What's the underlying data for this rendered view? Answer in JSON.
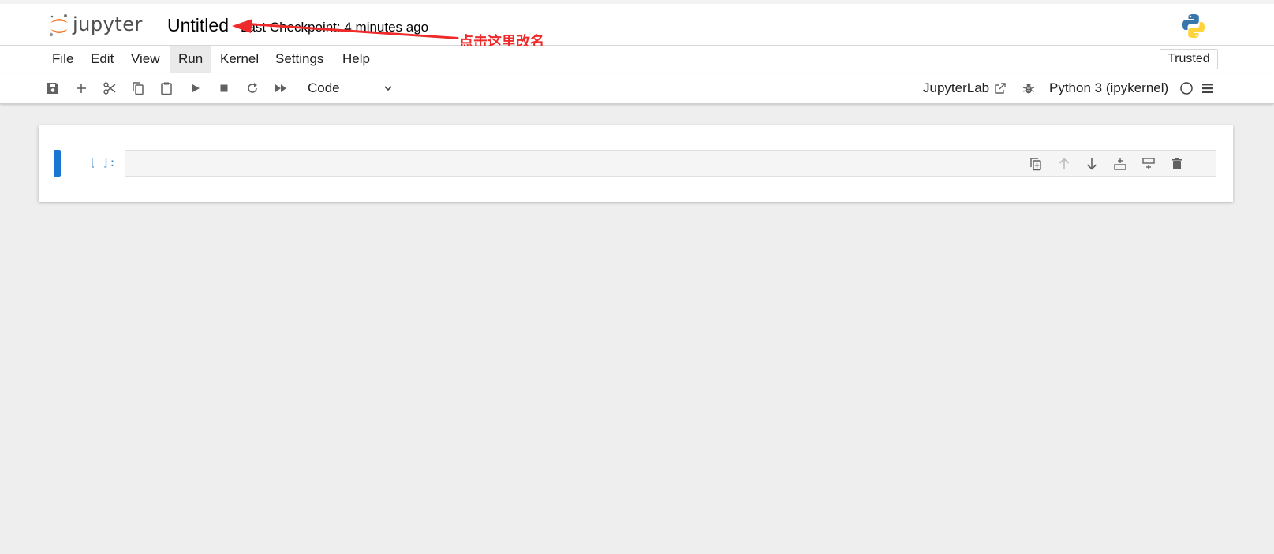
{
  "header": {
    "logo_text": "jupyter",
    "notebook_title": "Untitled",
    "checkpoint": "Last Checkpoint: 4 minutes ago",
    "annotation": "点击这里改名",
    "kernel_logo": "python-logo"
  },
  "menubar": {
    "items": [
      {
        "label": "File"
      },
      {
        "label": "Edit"
      },
      {
        "label": "View"
      },
      {
        "label": "Run",
        "active": true
      },
      {
        "label": "Kernel"
      },
      {
        "label": "Settings"
      },
      {
        "label": "Help"
      }
    ],
    "trusted_label": "Trusted"
  },
  "toolbar": {
    "icons": [
      "save-icon",
      "add-icon",
      "cut-icon",
      "copy-icon",
      "paste-icon",
      "run-icon",
      "stop-icon",
      "restart-icon",
      "fast-forward-icon"
    ],
    "cell_type": "Code",
    "jupyterlab_label": "JupyterLab",
    "kernel_label": "Python 3 (ipykernel)",
    "kernel_status": "idle"
  },
  "cell": {
    "prompt": "[ ]:",
    "source": "",
    "tools": [
      "duplicate-icon",
      "move-up-icon",
      "move-down-icon",
      "insert-above-icon",
      "insert-below-icon",
      "delete-icon"
    ]
  },
  "colors": {
    "accent": "#1976d2",
    "prompt": "#307fc1",
    "annotation": "#ee2a2a",
    "jupyter_orange": "#f37726"
  }
}
